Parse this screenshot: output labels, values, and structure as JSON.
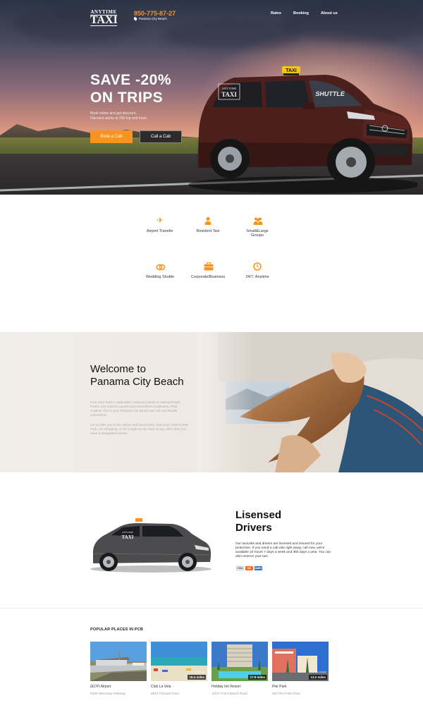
{
  "header": {
    "logo_top": "ANYTIME",
    "logo_main": "TAXI",
    "phone": "850-775-87-27",
    "location": "Panama City Beach",
    "nav": [
      "Rates",
      "Booking",
      "About us"
    ]
  },
  "hero": {
    "title_line1": "SAVE -20%",
    "title_line2": "ON TRIPS",
    "subtitle_line1": "Book online and get discount.",
    "subtitle_line2": "Discount works at 258 trip and more.",
    "book_button": "Book a Cab",
    "call_button": "Call a Cab",
    "taxi_sign": "TAXI",
    "windshield_text": "SHUTTLE"
  },
  "services": [
    {
      "icon": "plane-icon",
      "label": "Airport Transfer"
    },
    {
      "icon": "person-icon",
      "label": "Resident Taxi"
    },
    {
      "icon": "group-icon",
      "label": "Small&Large Groups"
    },
    {
      "icon": "rings-icon",
      "label": "Wedding Shuttle"
    },
    {
      "icon": "briefcase-icon",
      "label": "Corporate/Business"
    },
    {
      "icon": "clock-icon",
      "label": "24/7, Anytime"
    }
  ],
  "welcome": {
    "title_line1": "Welcome to",
    "title_line2": "Panama City Beach",
    "para1": "From Pier Park to Spinnaker, Harpoon Hanas to Hammerhead Fred's, any hotel to Lanela and everywhere in between, PCB Anytime Taxi is your Panama City Beach taxi cab and shuttle connection!",
    "para2": "Let us take you to the airport and back home, from your hotel to Pier Park, out shopping, or for a night on the town or any other time you need a Designated Driver."
  },
  "drivers": {
    "title_line1": "Lisensed",
    "title_line2": "Drivers",
    "text": "Our taxicabs and drivers are licensed and insured for your protection. If you need a cab ride right away, call now, we're available 24 hours 7 days a week and 365 days a year. You can also reserve your taxi.",
    "cards": [
      "VISA",
      "MC",
      "AMEX"
    ],
    "car_logo_top": "ANYTIME",
    "car_logo_main": "TAXI"
  },
  "popular": {
    "title": "POPULAR PLACES IN PCB",
    "places": [
      {
        "name": "(ECP) Airport",
        "address": "6300 West Bay Parkway",
        "distance": "",
        "distance_label": ""
      },
      {
        "name": "Club La Vela",
        "address": "8813 Thomas Drive",
        "distance": "19.4 miles",
        "distance_label": "from Airport"
      },
      {
        "name": "Holiday Inn Resort",
        "address": "11127 Front Beach Road",
        "distance": "17.9 miles",
        "distance_label": "from Airport"
      },
      {
        "name": "Pier Park",
        "address": "600 Pier Park Drive",
        "distance": "13.2 miles",
        "distance_label": "from Airport"
      }
    ]
  },
  "colors": {
    "accent": "#f7941d",
    "dark": "#2b2b2b"
  }
}
